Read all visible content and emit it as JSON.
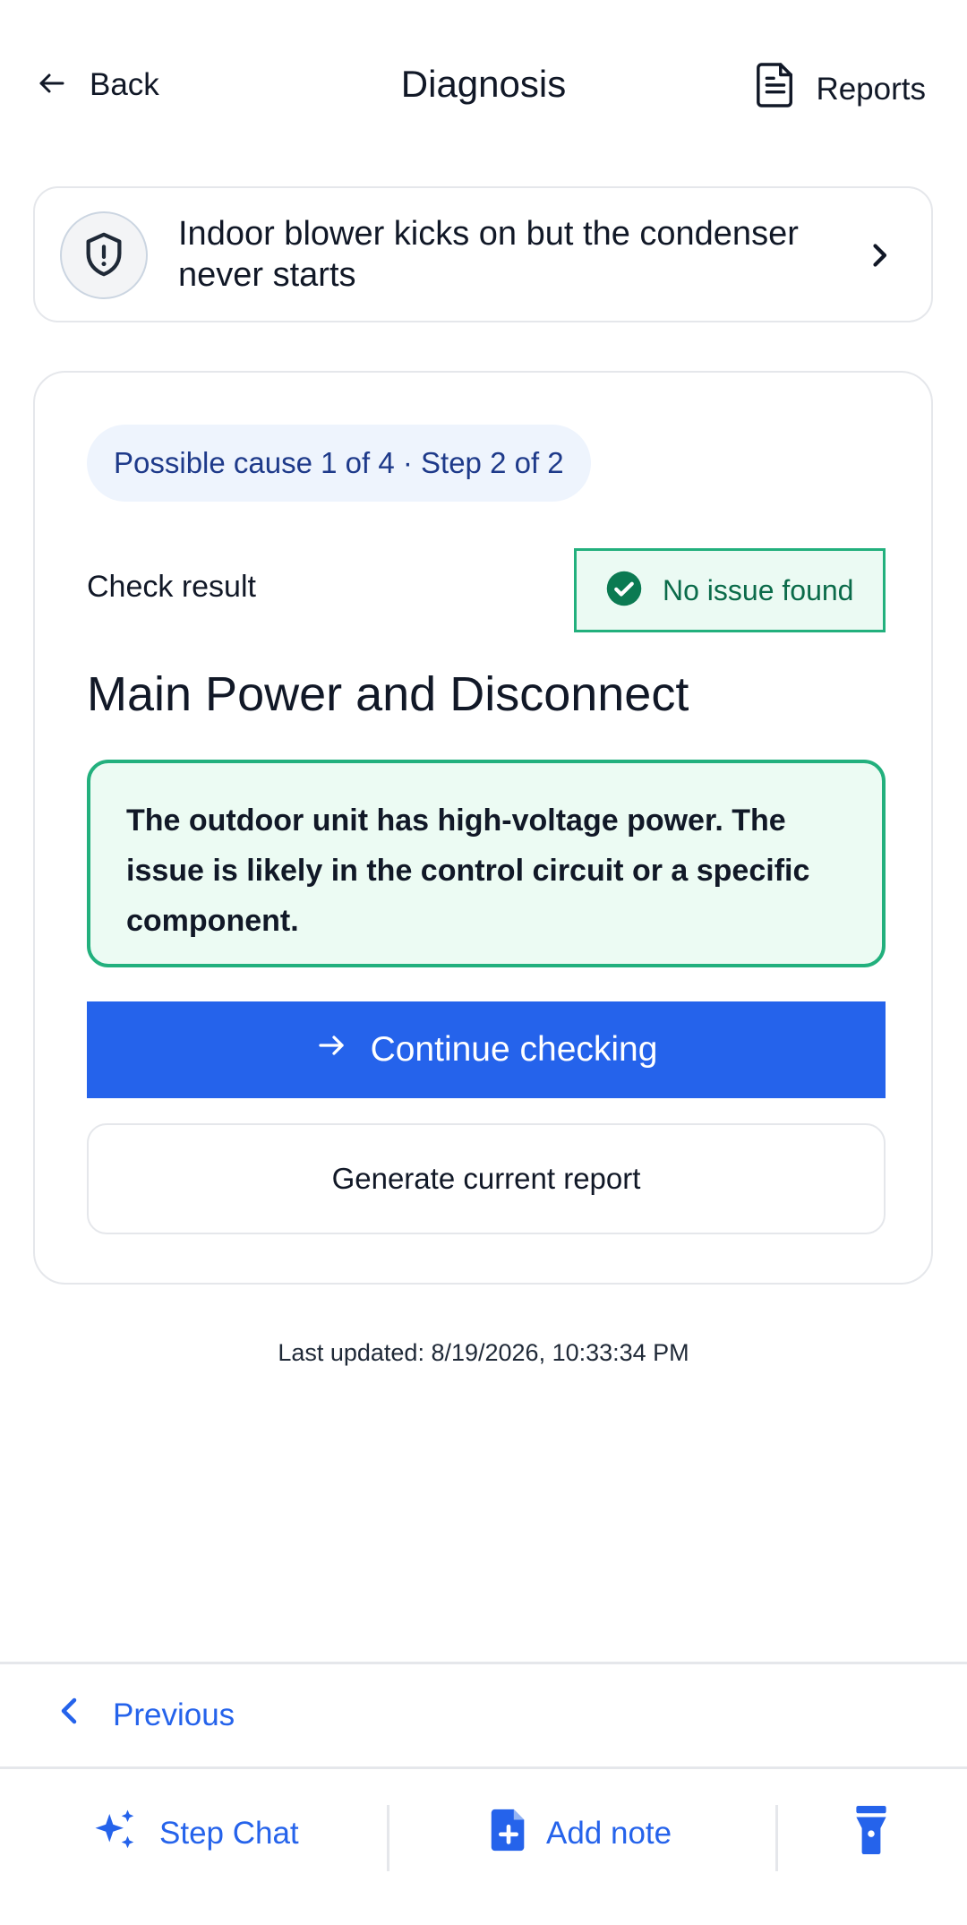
{
  "header": {
    "back_label": "Back",
    "title": "Diagnosis",
    "reports_label": "Reports"
  },
  "issue": {
    "text": "Indoor blower kicks on but the condenser never starts",
    "icon": "shield-alert-icon"
  },
  "step_card": {
    "progress_pill": "Possible cause 1 of 4 · Step 2 of 2",
    "check_result_label": "Check result",
    "status": "No issue found",
    "status_color": "#22b07d",
    "title": "Main Power and Disconnect",
    "result_message": "The outdoor unit has high-voltage power. The issue is likely in the control circuit or a specific component.",
    "continue_label": "Continue checking",
    "report_label": "Generate current report"
  },
  "last_updated": "Last updated: 8/19/2026, 10:33:34 PM",
  "nav": {
    "previous_label": "Previous"
  },
  "toolbar": {
    "step_chat_label": "Step Chat",
    "add_note_label": "Add note",
    "flashlight_icon": "flashlight-icon"
  },
  "colors": {
    "accent": "#2563eb",
    "success": "#22b07d"
  }
}
